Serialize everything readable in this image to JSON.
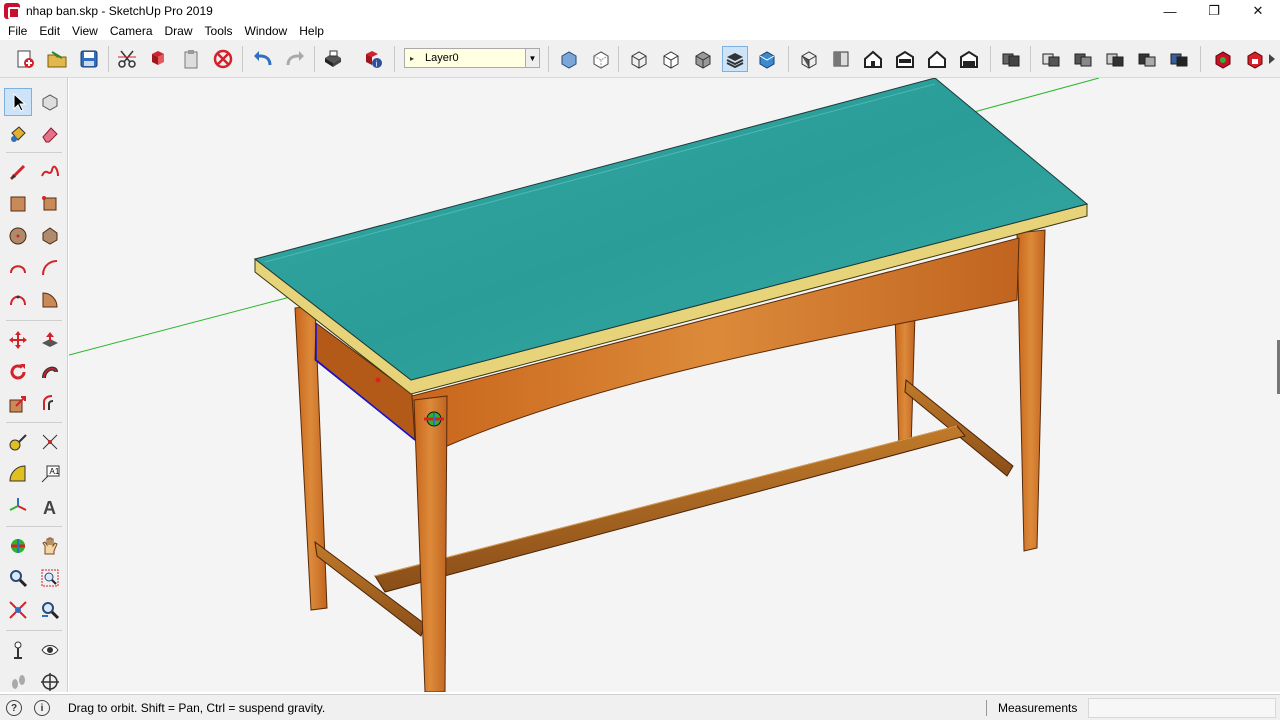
{
  "window": {
    "title": "nhap ban.skp - SketchUp Pro 2019",
    "controls": [
      "—",
      "❐",
      "✕"
    ]
  },
  "menu": [
    "File",
    "Edit",
    "View",
    "Camera",
    "Draw",
    "Tools",
    "Window",
    "Help"
  ],
  "toolbar": {
    "layer_value": "Layer0"
  },
  "statusbar": {
    "message": "Drag to orbit. Shift = Pan, Ctrl = suspend gravity.",
    "measurements_label": "Measurements",
    "measurements_value": ""
  },
  "colors": {
    "tabletop": "#2fa3a0",
    "edge_band": "#e6d37a",
    "wood": "#d27a2b",
    "green_axis": "#2bb52b",
    "selection": "#1010e0"
  }
}
